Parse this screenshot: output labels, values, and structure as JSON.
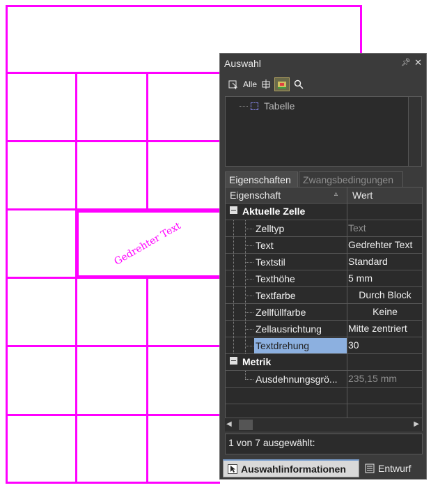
{
  "canvas": {
    "line_color": "#ff00ff",
    "rotated_text": "Gedrehter Text"
  },
  "palette": {
    "title": "Auswahl",
    "pin_icon": "pin-icon",
    "close_icon": "close-icon",
    "toolbar": {
      "quick_select_icon": "quick-select-icon",
      "select_all_label": "Alle",
      "toggle_icon": "pickadd-icon",
      "filter_icon": "filter-icon",
      "search_icon": "magnifier-icon"
    },
    "tree": {
      "item_label": "Tabelle"
    },
    "tabs": {
      "properties": "Eigenschaften",
      "constraints": "Zwangsbedingungen"
    },
    "grid": {
      "header_property": "Eigenschaft",
      "header_value": "Wert",
      "category_cell": "Aktuelle Zelle",
      "rows": [
        {
          "name": "Zelltyp",
          "value": "Text",
          "dim": true
        },
        {
          "name": "Text",
          "value": "Gedrehter Text"
        },
        {
          "name": "Textstil",
          "value": "Standard"
        },
        {
          "name": "Texthöhe",
          "value": "5 mm"
        },
        {
          "name": "Textfarbe",
          "value": "Durch Block"
        },
        {
          "name": "Zellfüllfarbe",
          "value": "Keine"
        },
        {
          "name": "Zellausrichtung",
          "value": "Mitte zentriert"
        },
        {
          "name": "Textdrehung",
          "value": "30"
        }
      ],
      "category_metric": "Metrik",
      "metric_rows": [
        {
          "name": "Ausdehnungsgrö...",
          "value": "235,15 mm"
        }
      ]
    },
    "status": "1 von 7 ausgewählt:",
    "bottom_tabs": {
      "info": "Auswahlinformationen",
      "design": "Entwurf"
    }
  }
}
